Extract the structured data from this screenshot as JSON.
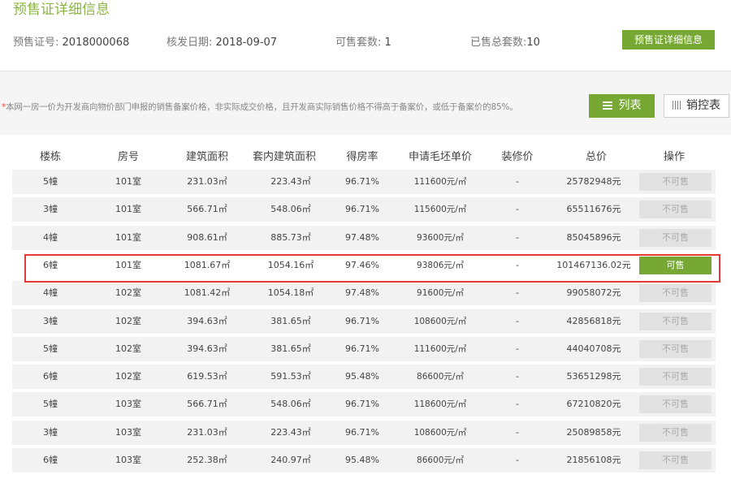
{
  "header": {
    "title": "预售证详细信息",
    "cert_label": "预售证号:",
    "cert_value": "2018000068",
    "date_label": "核发日期:",
    "date_value": "2018-09-07",
    "avail_label": "可售套数:",
    "avail_value": "1",
    "sold_label": "已售总套数:",
    "sold_value": "10",
    "detail_button": "预售证详细信息"
  },
  "notice": {
    "star": "*",
    "text": "本网一房一价为开发商向物价部门申报的销售备案价格，非实际成交价格，且开发商实际销售价格不得高于备案价，或低于备案价的85%。"
  },
  "toolbar": {
    "list_label": "列表",
    "control_label": "销控表"
  },
  "colors": {
    "accent": "#76a833",
    "highlight": "#e43a3a",
    "title": "#8cb645"
  },
  "icons": {
    "list": "list-icon",
    "grid": "grid-icon"
  },
  "table": {
    "headers": [
      "楼栋",
      "房号",
      "建筑面积",
      "套内建筑面积",
      "得房率",
      "申请毛坯单价",
      "装修价",
      "总价",
      "操作"
    ],
    "rows": [
      {
        "b": "5幢",
        "room": "101室",
        "area": "231.03㎡",
        "inner": "223.43㎡",
        "rate": "96.71%",
        "price": "111600元/㎡",
        "deco": "-",
        "total": "25782948元",
        "op": "不可售",
        "available": false
      },
      {
        "b": "3幢",
        "room": "101室",
        "area": "566.71㎡",
        "inner": "548.06㎡",
        "rate": "96.71%",
        "price": "115600元/㎡",
        "deco": "-",
        "total": "65511676元",
        "op": "不可售",
        "available": false
      },
      {
        "b": "4幢",
        "room": "101室",
        "area": "908.61㎡",
        "inner": "885.73㎡",
        "rate": "97.48%",
        "price": "93600元/㎡",
        "deco": "-",
        "total": "85045896元",
        "op": "不可售",
        "available": false
      },
      {
        "b": "6幢",
        "room": "101室",
        "area": "1081.67㎡",
        "inner": "1054.16㎡",
        "rate": "97.46%",
        "price": "93806元/㎡",
        "deco": "-",
        "total": "101467136.02元",
        "op": "可售",
        "available": true
      },
      {
        "b": "4幢",
        "room": "102室",
        "area": "1081.42㎡",
        "inner": "1054.18㎡",
        "rate": "97.48%",
        "price": "91600元/㎡",
        "deco": "-",
        "total": "99058072元",
        "op": "不可售",
        "available": false
      },
      {
        "b": "3幢",
        "room": "102室",
        "area": "394.63㎡",
        "inner": "381.65㎡",
        "rate": "96.71%",
        "price": "108600元/㎡",
        "deco": "-",
        "total": "42856818元",
        "op": "不可售",
        "available": false
      },
      {
        "b": "5幢",
        "room": "102室",
        "area": "394.63㎡",
        "inner": "381.65㎡",
        "rate": "96.71%",
        "price": "111600元/㎡",
        "deco": "-",
        "total": "44040708元",
        "op": "不可售",
        "available": false
      },
      {
        "b": "6幢",
        "room": "102室",
        "area": "619.53㎡",
        "inner": "591.53㎡",
        "rate": "95.48%",
        "price": "86600元/㎡",
        "deco": "-",
        "total": "53651298元",
        "op": "不可售",
        "available": false
      },
      {
        "b": "5幢",
        "room": "103室",
        "area": "566.71㎡",
        "inner": "548.06㎡",
        "rate": "96.71%",
        "price": "118600元/㎡",
        "deco": "-",
        "total": "67210820元",
        "op": "不可售",
        "available": false
      },
      {
        "b": "3幢",
        "room": "103室",
        "area": "231.03㎡",
        "inner": "223.43㎡",
        "rate": "96.71%",
        "price": "108600元/㎡",
        "deco": "-",
        "total": "25089858元",
        "op": "不可售",
        "available": false
      },
      {
        "b": "6幢",
        "room": "103室",
        "area": "252.38㎡",
        "inner": "240.97㎡",
        "rate": "95.48%",
        "price": "86600元/㎡",
        "deco": "-",
        "total": "21856108元",
        "op": "不可售",
        "available": false
      }
    ]
  }
}
